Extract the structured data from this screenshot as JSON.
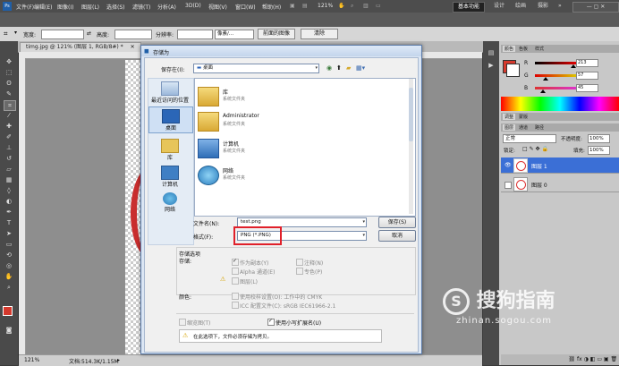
{
  "menubar": {
    "logo": "Ps",
    "items": [
      "文件(F)",
      "编辑(E)",
      "图像(I)",
      "图层(L)",
      "选择(S)",
      "滤镜(T)",
      "分析(A)",
      "3D(D)",
      "视图(V)",
      "窗口(W)",
      "帮助(H)"
    ],
    "zoom": "121%",
    "workspaces": [
      "基本功能",
      "设计",
      "绘画",
      "摄影"
    ]
  },
  "options_bar": {
    "width_label": "宽度:",
    "height_label": "高度:",
    "resolution_label": "分辨率:",
    "resolution_unit": "像素/...",
    "front_image_button": "前面的图像",
    "clear_button": "清除"
  },
  "document": {
    "tab_title": "timg.jpg @ 121% (图层 1, RGB/8#) *",
    "status_zoom": "121%",
    "status_doc": "文档:514.3K/1.15M"
  },
  "color_panel": {
    "tabs": [
      "颜色",
      "色板",
      "样式"
    ],
    "channels": [
      {
        "label": "R",
        "value": "213",
        "color": "#d52525",
        "level": 0.835
      },
      {
        "label": "G",
        "value": "57",
        "color": "#39c039",
        "level": 0.224
      },
      {
        "label": "B",
        "value": "45",
        "color": "#2d2dd5",
        "level": 0.176
      }
    ],
    "fg_color": "#d5392d"
  },
  "adjust_panel": {
    "tabs": [
      "调整",
      "蒙版"
    ]
  },
  "layers_panel": {
    "tabs": [
      "图层",
      "通道",
      "路径"
    ],
    "blend_mode": "正常",
    "opacity_label": "不透明度:",
    "opacity_value": "100%",
    "lock_label": "锁定:",
    "fill_label": "填充:",
    "fill_value": "100%",
    "layers": [
      {
        "name": "图层 1",
        "selected": true
      },
      {
        "name": "图层 0",
        "selected": false
      }
    ]
  },
  "dialog": {
    "title": "存储为",
    "save_in_label": "保存在(I):",
    "save_in_value": "桌面",
    "places": [
      "最近访问的位置",
      "桌面",
      "库",
      "计算机",
      "网络"
    ],
    "files": [
      {
        "name": "库",
        "desc": "系统文件夹"
      },
      {
        "name": "Administrator",
        "desc": "系统文件夹"
      },
      {
        "name": "计算机",
        "desc": "系统文件夹"
      },
      {
        "name": "网络",
        "desc": "系统文件夹"
      }
    ],
    "filename_label": "文件名(N):",
    "filename_value": "test.png",
    "format_label": "格式(F):",
    "format_value": "PNG (*.PNG)",
    "save_button": "保存(S)",
    "cancel_button": "取消",
    "save_options_title": "存储选项",
    "save_sub": "存储:",
    "opt_as_copy": "作为副本(Y)",
    "opt_annotations": "注释(N)",
    "opt_alpha": "Alpha 通道(E)",
    "opt_spot": "专色(P)",
    "opt_layers": "图层(L)",
    "color_label": "颜色:",
    "opt_proof": "使用校样设置(O): 工作中的 CMYK",
    "opt_icc": "ICC 配置文件(C): sRGB IEC61966-2.1",
    "opt_thumbnail": "缩览图(T)",
    "opt_lowercase": "使用小写扩展名(U)",
    "warning": "在此选项下，文件必须存储为拷贝。"
  },
  "watermark": {
    "text": "搜狗指南",
    "url": "zhinan.sogou.com"
  },
  "colors": {
    "highlight": "#e0202a",
    "dialog_border": "#5a7aa8"
  }
}
